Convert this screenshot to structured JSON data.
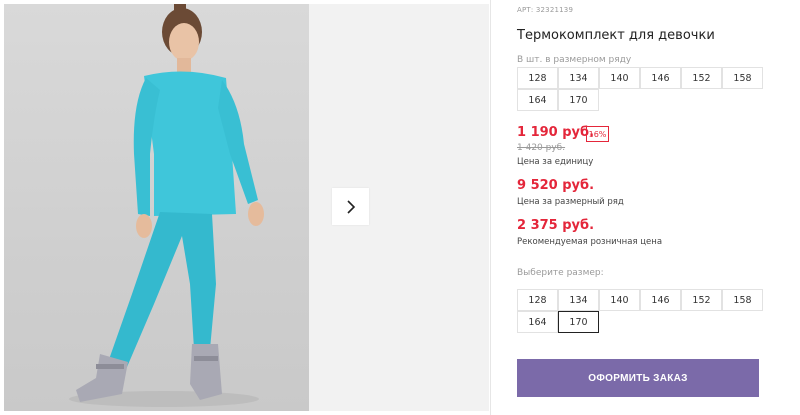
{
  "product": {
    "sku": "АРТ: 32321139",
    "title": "Термокомплект для девочки"
  },
  "size_row": {
    "label": "В шт. в размерном ряду",
    "sizes": [
      "128",
      "134",
      "140",
      "146",
      "152",
      "158",
      "164",
      "170"
    ]
  },
  "pricing": {
    "price": "1 190 руб.",
    "discount": "16%",
    "old_price": "1 420 руб.",
    "unit_caption": "Цена за единицу",
    "row_price": "9 520 руб.",
    "row_caption": "Цена за размерный ряд",
    "retail_price": "2 375 руб.",
    "retail_caption": "Рекомендуемая розничная цена"
  },
  "size_select": {
    "label": "Выберите размер:",
    "sizes": [
      "128",
      "134",
      "140",
      "146",
      "152",
      "158",
      "164",
      "170"
    ],
    "selected": "170"
  },
  "order_button": "ОФОРМИТЬ ЗАКАЗ",
  "gallery": {
    "next_icon": "chevron-right-icon"
  },
  "colors": {
    "price_red": "#e4263a",
    "button_purple": "#7b6aa9",
    "outfit_turquoise": "#3dc5d8"
  }
}
